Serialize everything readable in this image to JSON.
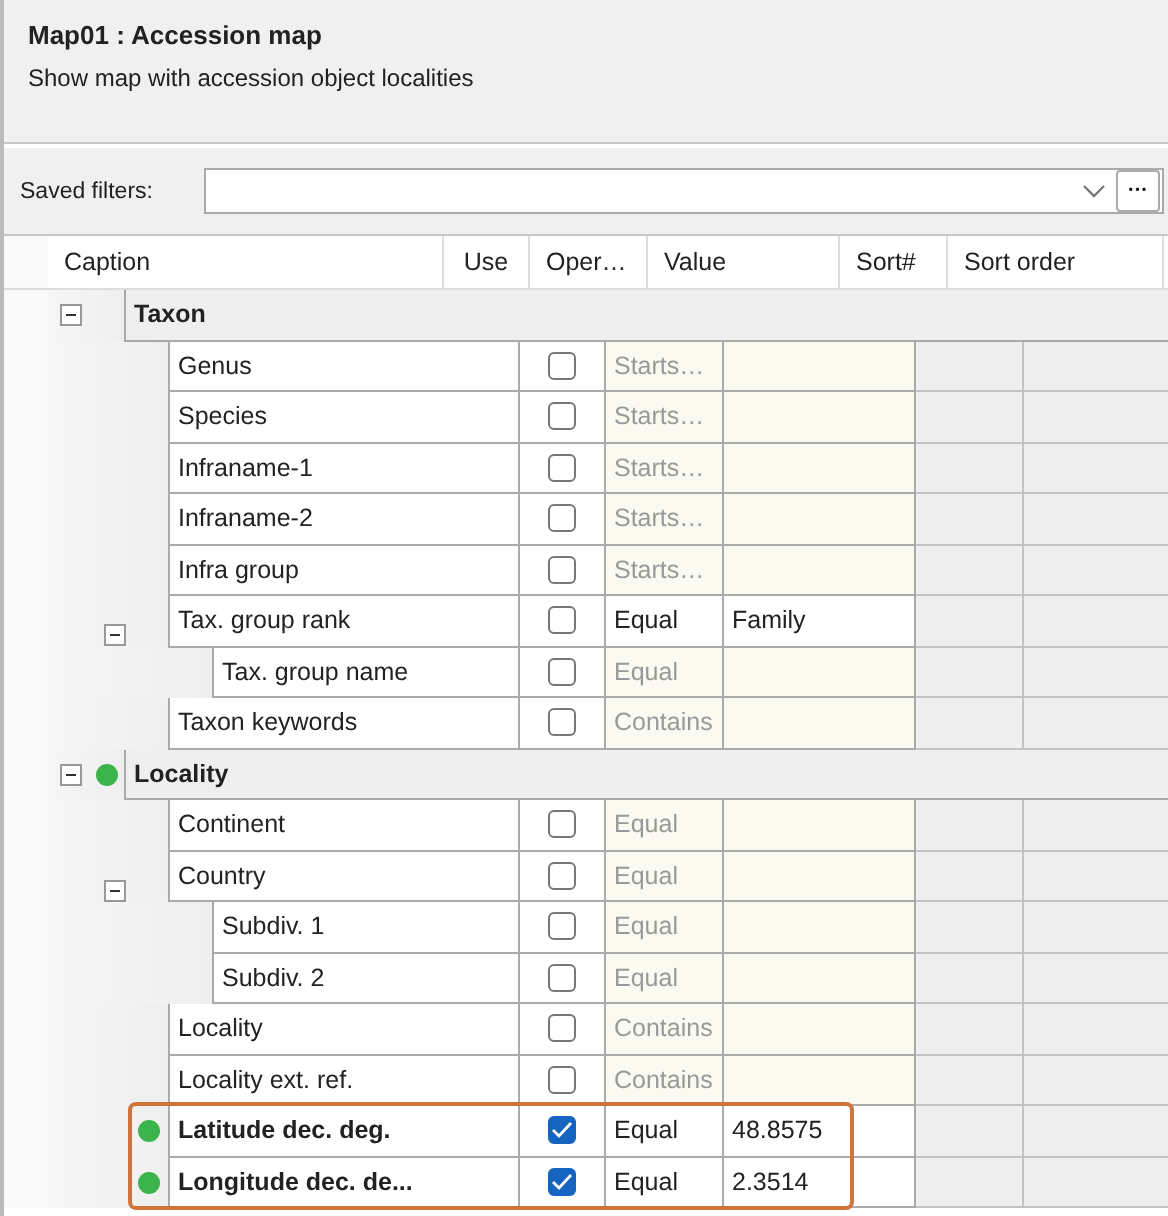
{
  "header": {
    "title": "Map01 : Accession map",
    "subtitle": "Show map with accession object localities"
  },
  "saved_filters": {
    "label": "Saved filters:",
    "more_button": "···"
  },
  "columns": [
    "Caption",
    "Use",
    "Oper…",
    "Value",
    "Sort#",
    "Sort order"
  ],
  "groups": [
    {
      "caption": "Taxon",
      "expanded": true,
      "active": false,
      "fields": [
        {
          "caption": "Genus",
          "checked": false,
          "filled": false,
          "active": false,
          "operator": "Starts…"
        },
        {
          "caption": "Species",
          "checked": false,
          "filled": false,
          "active": false,
          "operator": "Starts…"
        },
        {
          "caption": "Infraname-1",
          "checked": false,
          "filled": false,
          "active": false,
          "operator": "Starts…"
        },
        {
          "caption": "Infraname-2",
          "checked": false,
          "filled": false,
          "active": false,
          "operator": "Starts…"
        },
        {
          "caption": "Infra group",
          "checked": false,
          "filled": false,
          "active": false,
          "operator": "Starts…"
        },
        {
          "caption": "Tax. group rank",
          "checked": false,
          "filled": true,
          "active": false,
          "operator": "Equal",
          "value": "Family",
          "expanded": true,
          "children": [
            {
              "caption": "Tax. group name",
              "checked": false,
              "filled": false,
              "active": false,
              "operator": "Equal"
            }
          ]
        },
        {
          "caption": "Taxon keywords",
          "checked": false,
          "filled": false,
          "active": false,
          "operator": "Contains"
        }
      ]
    },
    {
      "caption": "Locality",
      "expanded": true,
      "active": true,
      "fields": [
        {
          "caption": "Continent",
          "checked": false,
          "filled": false,
          "active": false,
          "operator": "Equal"
        },
        {
          "caption": "Country",
          "checked": false,
          "filled": false,
          "active": false,
          "operator": "Equal",
          "expanded": true,
          "children": [
            {
              "caption": "Subdiv. 1",
              "checked": false,
              "filled": false,
              "active": false,
              "operator": "Equal"
            },
            {
              "caption": "Subdiv. 2",
              "checked": false,
              "filled": false,
              "active": false,
              "operator": "Equal"
            }
          ]
        },
        {
          "caption": "Locality",
          "checked": false,
          "filled": false,
          "active": false,
          "operator": "Contains"
        },
        {
          "caption": "Locality ext. ref.",
          "checked": false,
          "filled": false,
          "active": false,
          "operator": "Contains"
        },
        {
          "caption": "Latitude dec. deg.",
          "checked": true,
          "filled": true,
          "active": true,
          "highlighted": true,
          "operator": "Equal",
          "value": "48.8575"
        },
        {
          "caption": "Longitude dec. de...",
          "checked": true,
          "filled": true,
          "active": true,
          "highlighted": true,
          "operator": "Equal",
          "value": "2.3514"
        }
      ]
    }
  ]
}
